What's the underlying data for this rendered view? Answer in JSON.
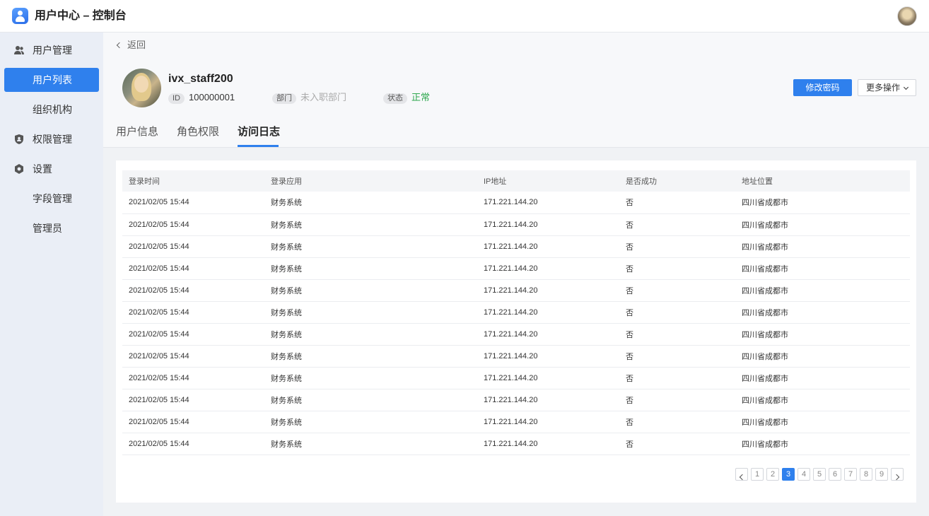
{
  "app": {
    "title": "用户中心 – 控制台",
    "logo_icon": "user-app-icon"
  },
  "sidebar": {
    "items": [
      {
        "label": "用户管理",
        "icon": "users-icon"
      },
      {
        "label": "用户列表",
        "active": true
      },
      {
        "label": "组织机构"
      },
      {
        "label": "权限管理",
        "icon": "shield-icon"
      },
      {
        "label": "设置",
        "icon": "gear-icon"
      },
      {
        "label": "字段管理"
      },
      {
        "label": "管理员"
      }
    ]
  },
  "header": {
    "back_label": "返回",
    "username": "ivx_staff200",
    "id_tag": "ID",
    "id_value": "100000001",
    "dept_tag": "部门",
    "dept_value": "未入职部门",
    "status_tag": "状态",
    "status_value": "正常",
    "change_password_label": "修改密码",
    "more_actions_label": "更多操作"
  },
  "tabs": [
    {
      "label": "用户信息"
    },
    {
      "label": "角色权限"
    },
    {
      "label": "访问日志",
      "active": true
    }
  ],
  "table": {
    "columns": [
      "登录时间",
      "登录应用",
      "IP地址",
      "是否成功",
      "地址位置"
    ],
    "rows": [
      [
        "2021/02/05 15:44",
        "财务系统",
        "171.221.144.20",
        "否",
        "四川省成都市"
      ],
      [
        "2021/02/05 15:44",
        "财务系统",
        "171.221.144.20",
        "否",
        "四川省成都市"
      ],
      [
        "2021/02/05 15:44",
        "财务系统",
        "171.221.144.20",
        "否",
        "四川省成都市"
      ],
      [
        "2021/02/05 15:44",
        "财务系统",
        "171.221.144.20",
        "否",
        "四川省成都市"
      ],
      [
        "2021/02/05 15:44",
        "财务系统",
        "171.221.144.20",
        "否",
        "四川省成都市"
      ],
      [
        "2021/02/05 15:44",
        "财务系统",
        "171.221.144.20",
        "否",
        "四川省成都市"
      ],
      [
        "2021/02/05 15:44",
        "财务系统",
        "171.221.144.20",
        "否",
        "四川省成都市"
      ],
      [
        "2021/02/05 15:44",
        "财务系统",
        "171.221.144.20",
        "否",
        "四川省成都市"
      ],
      [
        "2021/02/05 15:44",
        "财务系统",
        "171.221.144.20",
        "否",
        "四川省成都市"
      ],
      [
        "2021/02/05 15:44",
        "财务系统",
        "171.221.144.20",
        "否",
        "四川省成都市"
      ],
      [
        "2021/02/05 15:44",
        "财务系统",
        "171.221.144.20",
        "否",
        "四川省成都市"
      ],
      [
        "2021/02/05 15:44",
        "财务系统",
        "171.221.144.20",
        "否",
        "四川省成都市"
      ]
    ]
  },
  "pagination": {
    "pages": [
      "1",
      "2",
      "3",
      "4",
      "5",
      "6",
      "7",
      "8",
      "9"
    ],
    "current": "3"
  },
  "colors": {
    "accent": "#2f80ed",
    "status_ok": "#2fa84f",
    "sidebar_bg": "#eaeef6"
  }
}
